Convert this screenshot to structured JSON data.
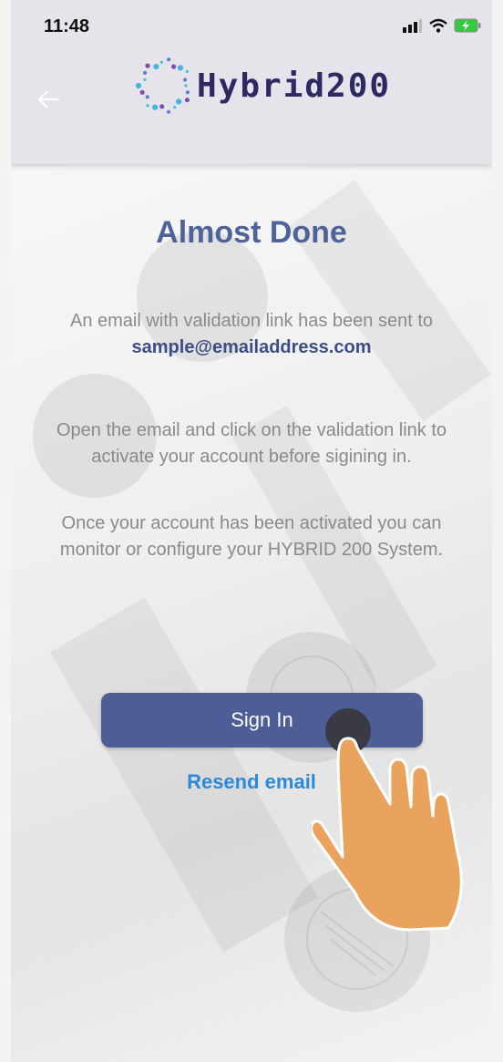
{
  "status_bar": {
    "time": "11:48"
  },
  "app_bar": {
    "brand": "Hybrid200"
  },
  "main": {
    "title": "Almost Done",
    "message_line": "An email with validation link has been sent to",
    "email": "sample@emailaddress.com",
    "instructions": "Open the email and click on the validation link to activate your account before sigining in.",
    "activation_note": "Once your account has been activated you can monitor or configure your HYBRID 200 System.",
    "sign_in_label": "Sign In",
    "resend_label": "Resend email"
  },
  "colors": {
    "app_bar": "#e6e3ea",
    "title": "#4f629a",
    "primary_button": "#4d5e96",
    "link": "#2a8ad8",
    "hand": "#e9a35c"
  },
  "icons": [
    "back-arrow-icon",
    "cellular-signal-icon",
    "wifi-icon",
    "battery-charging-icon",
    "logo-icon",
    "pointer-hand-icon"
  ]
}
